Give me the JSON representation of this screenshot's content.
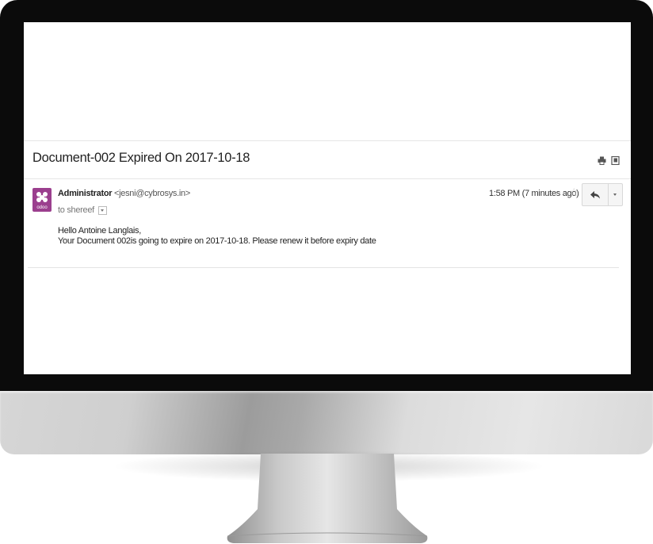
{
  "email": {
    "subject": "Document-002 Expired On 2017-10-18",
    "sender_name": "Administrator",
    "sender_email": "<jesni@cybrosys.in>",
    "to_line": "to shereef",
    "time": "1:58 PM (7 minutes ago)",
    "avatar_label": "odoo",
    "body_line1": "Hello Antoine Langlais,",
    "body_line2": "Your Document 002is going to expire on 2017-10-18. Please renew it before expiry date"
  },
  "icons": {
    "print": "print-icon",
    "new_window": "new-window-icon",
    "star": "star-icon",
    "reply": "reply-icon",
    "more": "chevron-down-icon"
  },
  "colors": {
    "avatar": "#9b3f8e",
    "bezel": "#0b0b0b"
  }
}
